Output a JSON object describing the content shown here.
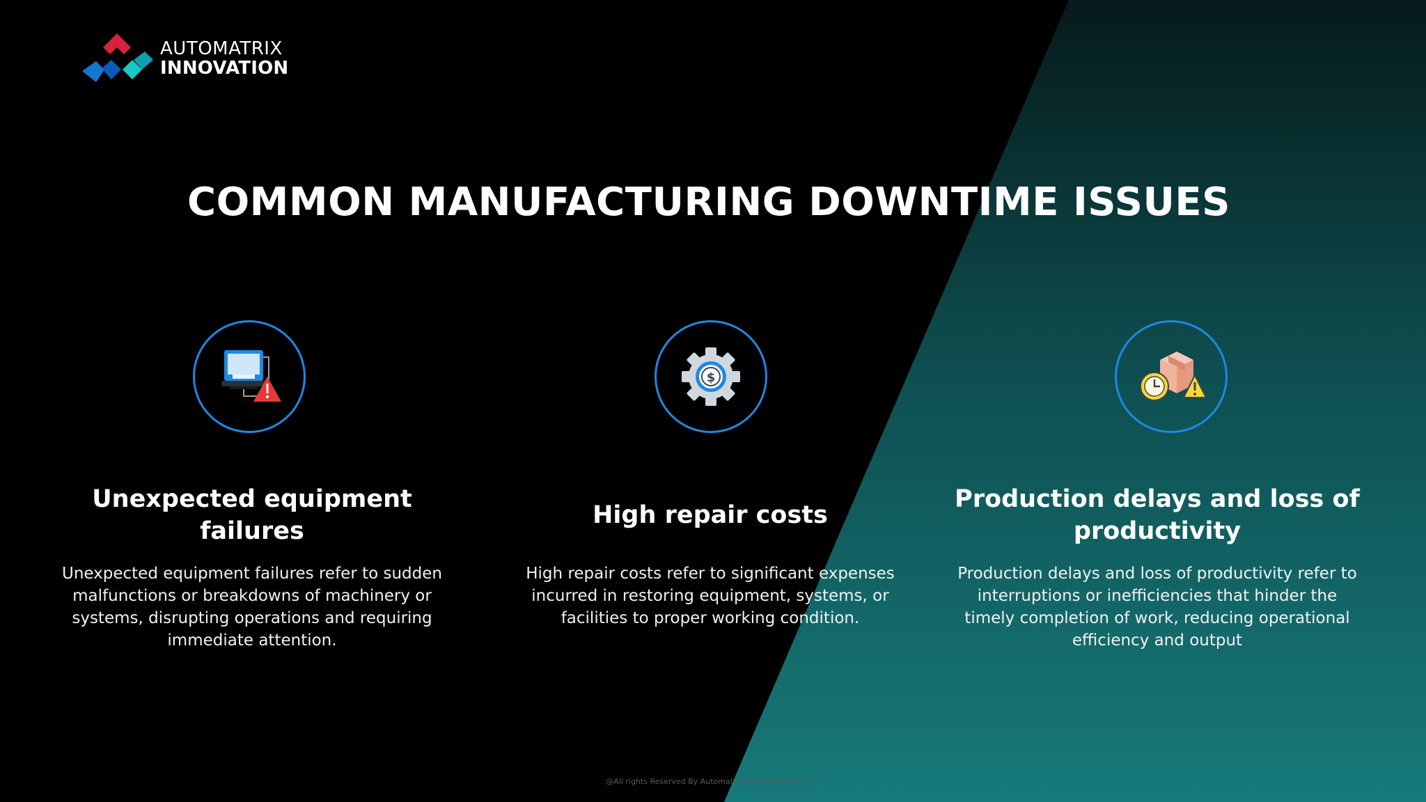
{
  "brand": {
    "line1": "AUTOMATRIX",
    "line2": "INNOVATION"
  },
  "title": "COMMON MANUFACTURING DOWNTIME ISSUES",
  "cards": [
    {
      "title_l1": "Unexpected equipment",
      "title_l2": "failures",
      "desc_l1": "Unexpected equipment failures refer to sudden",
      "desc_l2": "malfunctions or breakdowns of machinery or",
      "desc_l3": "systems, disrupting operations and requiring",
      "desc_l4": "immediate attention.",
      "icon": "computer-alert-icon"
    },
    {
      "title_l1": "High repair costs",
      "desc_l1": "High repair costs refer to significant expenses",
      "desc_l2": "incurred in restoring equipment, systems, or",
      "desc_l3": "facilities to proper working condition.",
      "icon": "gear-dollar-icon"
    },
    {
      "title_l1": "Production delays and loss of",
      "title_l2": "productivity",
      "desc_l1": "Production delays and loss of productivity refer to",
      "desc_l2": "interruptions or inefficiencies that hinder the",
      "desc_l3": "timely completion of work, reducing operational",
      "desc_l4": "efficiency and output",
      "icon": "clock-box-warning-icon"
    }
  ],
  "footer": "@All rights Reserved By Automatrix Innovation Pvt. Ltd.",
  "colors": {
    "background": "#000000",
    "teal_light": "#177a7a",
    "teal_dark": "#062020",
    "icon_ring": "#1e88e5",
    "text": "#ffffff"
  }
}
